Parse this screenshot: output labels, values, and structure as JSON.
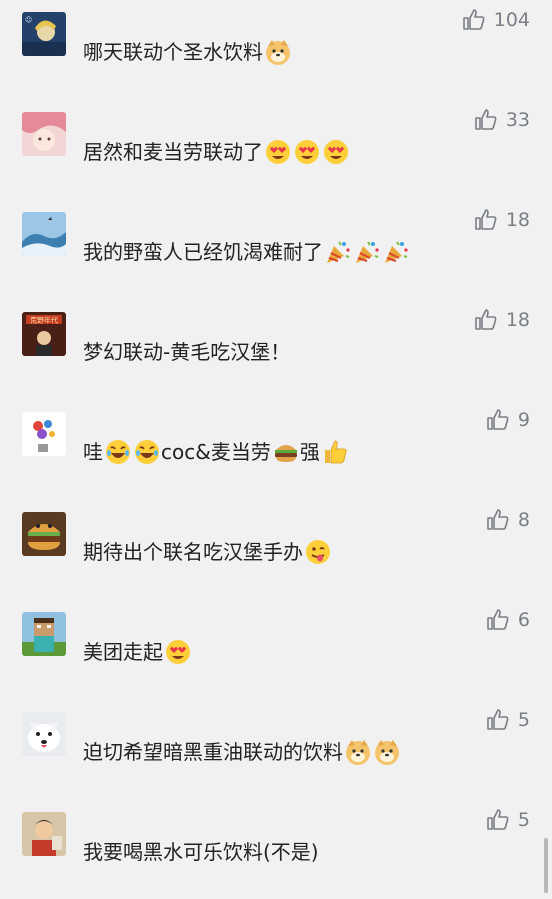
{
  "comments": [
    {
      "text": "哪天联动个圣水饮料",
      "likes": "104",
      "emojis": [
        "doge-emoji"
      ]
    },
    {
      "text": "居然和麦当劳联动了",
      "likes": "33",
      "emojis": [
        "heart-eyes-emoji",
        "heart-eyes-emoji",
        "heart-eyes-emoji"
      ]
    },
    {
      "text": "我的野蛮人已经饥渴难耐了",
      "likes": "18",
      "emojis": [
        "party-popper-emoji",
        "party-popper-emoji",
        "party-popper-emoji"
      ]
    },
    {
      "text": "梦幻联动-黄毛吃汉堡！",
      "likes": "18",
      "emojis": []
    },
    {
      "text_parts": [
        "哇",
        "coc&麦当劳",
        " 强"
      ],
      "likes": "9",
      "emojis": [
        "rofl-emoji",
        "rofl-emoji",
        "hamburger-emoji",
        "thumbs-up-emoji"
      ]
    },
    {
      "text": "期待出个联名吃汉堡手办",
      "likes": "8",
      "emojis": [
        "wink-tongue-emoji"
      ]
    },
    {
      "text": "美团走起",
      "likes": "6",
      "emojis": [
        "heart-eyes-emoji"
      ]
    },
    {
      "text": "迫切希望暗黑重油联动的饮料",
      "likes": "5",
      "emojis": [
        "doge-emoji",
        "doge-emoji"
      ]
    },
    {
      "text": "我要喝黑水可乐饮料(不是)",
      "likes": "5",
      "emojis": []
    }
  ],
  "avatar_badge_text": "荒野年代",
  "colors": {
    "background": "#f1f1f1",
    "text": "#222222",
    "like": "#7a7f86"
  }
}
